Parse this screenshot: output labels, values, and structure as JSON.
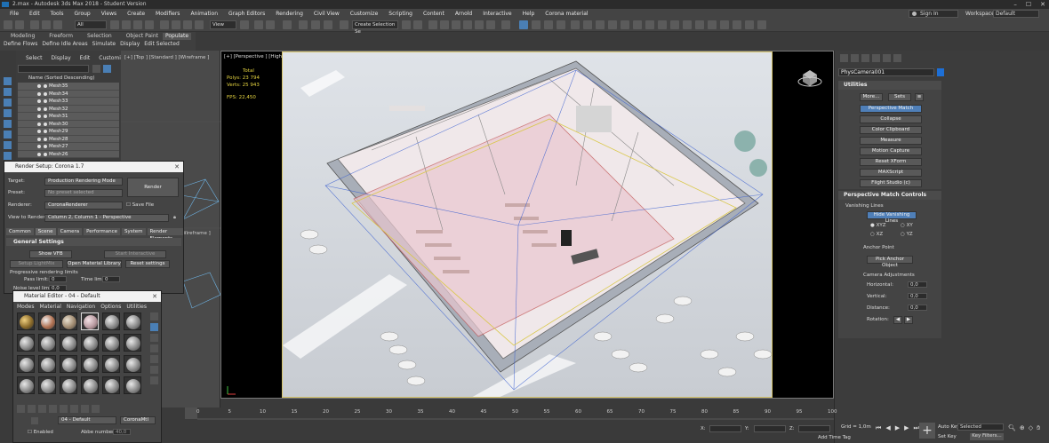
{
  "window": {
    "title": "2.max - Autodesk 3ds Max 2018 - Student Version"
  },
  "menu": [
    "File",
    "Edit",
    "Tools",
    "Group",
    "Views",
    "Create",
    "Modifiers",
    "Animation",
    "Graph Editors",
    "Rendering",
    "Civil View",
    "Customize",
    "Scripting",
    "Content",
    "Arnold",
    "Interactive",
    "Help",
    "Corona material"
  ],
  "account": {
    "signin": "Sign In",
    "workspaces_label": "Workspaces:",
    "workspace": "Default"
  },
  "toolbar": {
    "filter_select": "All",
    "view_select": "View",
    "selection_set": "Create Selection Se"
  },
  "ribbon": {
    "tabs": [
      "Modeling",
      "Freeform",
      "Selection",
      "Object Paint"
    ],
    "populate": "Populate",
    "subitems": [
      "Define Flows",
      "Define Idle Areas",
      "Simulate",
      "Display",
      "Edit Selected"
    ]
  },
  "scene_explorer": {
    "tabs": [
      "Select",
      "Display",
      "Edit",
      "Customize"
    ],
    "header": "Name (Sorted Descending)",
    "rows": [
      "Mesh35",
      "Mesh34",
      "Mesh33",
      "Mesh32",
      "Mesh31",
      "Mesh30",
      "Mesh29",
      "Mesh28",
      "Mesh27",
      "Mesh26"
    ]
  },
  "viewports": {
    "left_label": "[+] [Top ] [Standard ] [Wireframe ]",
    "left_label2": "[Wireframe ]",
    "main_label": "[+] [Perspective ] [High Quality ] [Default Shading ]",
    "stats": {
      "total": "Total",
      "polys_label": "Polys:",
      "polys": "23 794",
      "verts_label": "Verts:",
      "verts": "25 943",
      "fps_label": "FPS:",
      "fps": "22,450"
    }
  },
  "render_setup": {
    "title": "Render Setup: Corona 1.7",
    "target_label": "Target:",
    "target": "Production Rendering Mode",
    "preset_label": "Preset:",
    "preset": "No preset selected",
    "renderer_label": "Renderer:",
    "renderer": "CoronaRenderer",
    "save_file": "Save File",
    "view_label": "View to Render:",
    "view": "Column 2, Column 1 - Perspective",
    "render_btn": "Render",
    "tabs": [
      "Common",
      "Scene",
      "Camera",
      "Performance",
      "System",
      "Render Elements"
    ],
    "section": "General Settings",
    "show_vfb": "Show VFB",
    "start_interactive": "Start Interactive",
    "setup_lightmix": "Setup LightMix",
    "open_material_library": "Open Material Library",
    "reset_settings": "Reset settings",
    "progressive": "Progressive rendering limits",
    "pass_limit_label": "Pass limit:",
    "pass_limit": "0",
    "time_limit_label": "Time limit:",
    "time_limit": "0",
    "noise_label": "Noise level limit:",
    "noise": "0,0"
  },
  "material_editor": {
    "title": "Material Editor - 04 - Default",
    "menu": [
      "Modes",
      "Material",
      "Navigation",
      "Options",
      "Utilities"
    ],
    "material_name": "04 - Default",
    "material_type": "CoronaMtl",
    "enabled": "Enabled",
    "abbe_label": "Abbe number:",
    "abbe": "40,0"
  },
  "command_panel": {
    "object_name": "PhysCamera001",
    "utilities_title": "Utilities",
    "more": "More...",
    "sets": "Sets",
    "utility_buttons": [
      "Perspective Match",
      "Collapse",
      "Color Clipboard",
      "Measure",
      "Motion Capture",
      "Reset XForm",
      "MAXScript",
      "Flight Studio (c)"
    ],
    "pm_title": "Perspective Match Controls",
    "vanishing_lines": "Vanishing Lines",
    "hide_vanishing": "Hide Vanishing Lines",
    "axes": [
      "XYZ",
      "XY",
      "XZ",
      "YZ"
    ],
    "anchor_point": "Anchor Point",
    "pick_anchor": "Pick Anchor Object",
    "camera_adjustments": "Camera Adjustments",
    "horizontal_label": "Horizontal:",
    "horizontal": "0,0",
    "vertical_label": "Vertical:",
    "vertical": "0,0",
    "distance_label": "Distance:",
    "distance": "0,0",
    "rotation_label": "Rotation:"
  },
  "timeline": {
    "ticks": [
      "0",
      "5",
      "10",
      "15",
      "20",
      "25",
      "30",
      "35",
      "40",
      "45",
      "50",
      "55",
      "60",
      "65",
      "70",
      "75",
      "80",
      "85",
      "90",
      "95",
      "100"
    ]
  },
  "status": {
    "x_label": "X:",
    "y_label": "Y:",
    "z_label": "Z:",
    "grid": "Grid = 1,0m",
    "add_time_tag": "Add Time Tag",
    "auto_key": "Auto Key",
    "selected": "Selected",
    "set_key": "Set Key",
    "key_filters": "Key Filters..."
  }
}
